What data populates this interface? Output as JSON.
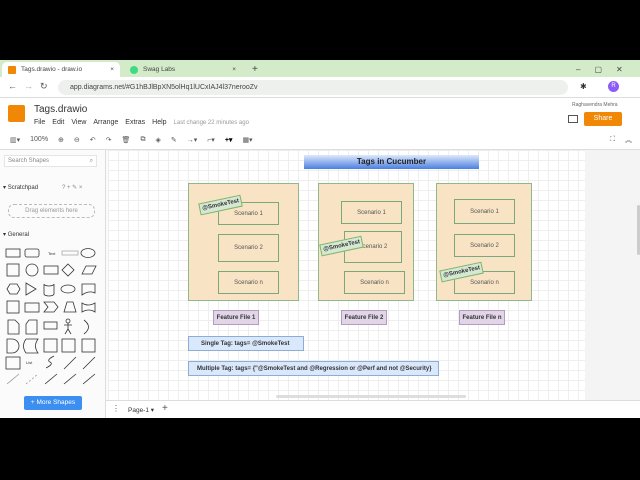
{
  "browser": {
    "tabs": [
      {
        "title": "Tags.drawio - draw.io"
      },
      {
        "title": "Swag Labs"
      }
    ],
    "url": "app.diagrams.net/#G1hBJlBpXN5olHq1lUCxIAJ4l37nerooZv",
    "profile_initial": "R"
  },
  "app": {
    "title": "Tags.drawio",
    "menu": [
      "File",
      "Edit",
      "View",
      "Arrange",
      "Extras",
      "Help"
    ],
    "last_change": "Last change 22 minutes ago",
    "user": "Raghavendra Mehra",
    "share_label": "Share",
    "zoom": "100%"
  },
  "sidebar": {
    "search_placeholder": "Search Shapes",
    "scratchpad": "Scratchpad",
    "scratch_icons": "? + ✎ ×",
    "drag_hint": "Drag elements here",
    "general": "General",
    "more_shapes": "+ More Shapes"
  },
  "diagram": {
    "title": "Tags in Cucumber",
    "features": [
      {
        "label": "Feature File 1",
        "scenarios": [
          "Scenario 1",
          "Scenario 2",
          "Scenario n"
        ]
      },
      {
        "label": "Feature File 2",
        "scenarios": [
          "Scenario 1",
          "Scenario 2",
          "Scenario n"
        ]
      },
      {
        "label": "Feature File n",
        "scenarios": [
          "Scenario 1",
          "Scenario 2",
          "Scenario n"
        ]
      }
    ],
    "tag": "@SmokeTest",
    "single_tag": "Single Tag: tags= @SmokeTest",
    "multiple_tag": "Multiple Tag: tags= {\"@SmokeTest and @Regression or @Perf and not @Security}"
  },
  "pages": {
    "current": "Page-1"
  }
}
